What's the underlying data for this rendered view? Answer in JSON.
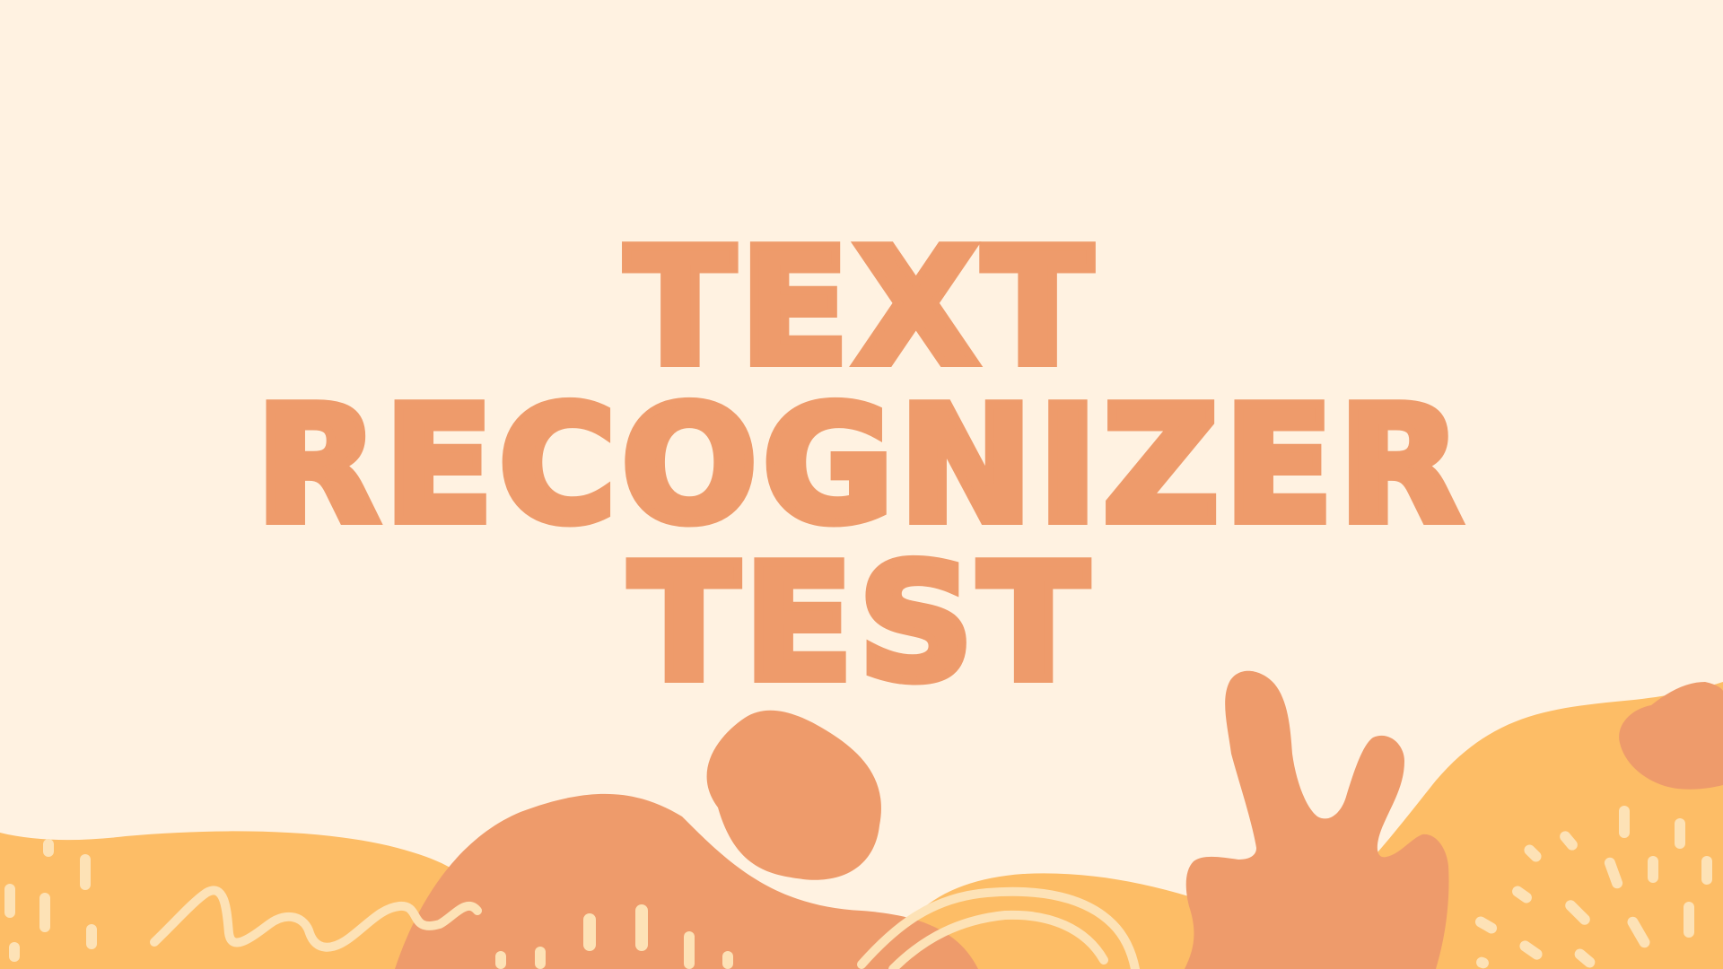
{
  "title": {
    "line1": "TEXT",
    "line2": "RECOGNIZER",
    "line3": "TEST"
  },
  "colors": {
    "background": "#fff2e1",
    "title": "#ee9b6b",
    "sand": "#fdbd66",
    "terracotta": "#ee9b6b",
    "cream_marks": "#fde2b6"
  }
}
